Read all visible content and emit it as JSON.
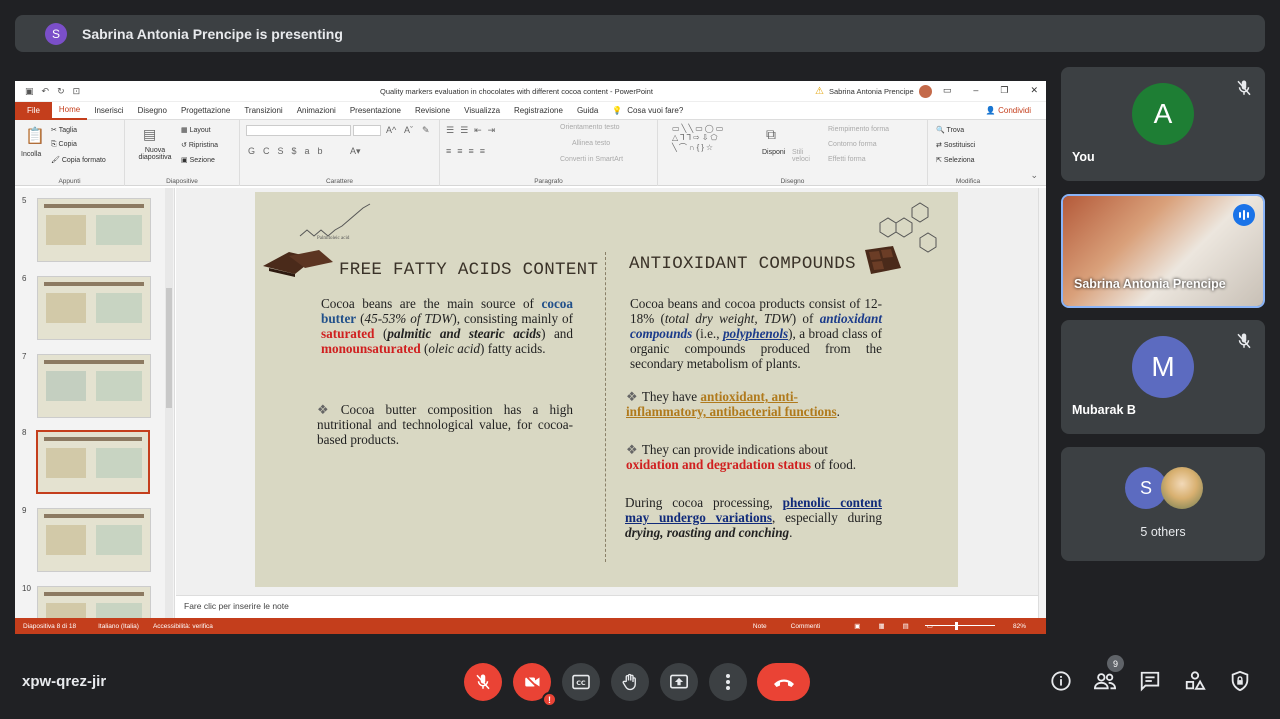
{
  "presenter_banner": {
    "avatar_letter": "S",
    "text": "Sabrina Antonia Prencipe is presenting"
  },
  "ppt": {
    "doc_title": "Quality markers evaluation in chocolates with different cocoa content  -  PowerPoint",
    "user_name": "Sabrina Antonia Prencipe",
    "menu": [
      "File",
      "Home",
      "Inserisci",
      "Disegno",
      "Progettazione",
      "Transizioni",
      "Animazioni",
      "Presentazione",
      "Revisione",
      "Visualizza",
      "Registrazione",
      "Guida"
    ],
    "tell_me": "Cosa vuoi fare?",
    "share": "Condividi",
    "ribbon": {
      "paste": "Incolla",
      "cut": "Taglia",
      "copy": "Copia",
      "format_painter": "Copia formato",
      "clipboard_group": "Appunti",
      "new_slide": "Nuova diapositiva",
      "layout": "Layout",
      "reset": "Ripristina",
      "section": "Sezione",
      "slides_group": "Diapositive",
      "font_group": "Carattere",
      "text_direction": "Orientamento testo",
      "align_text": "Allinea testo",
      "smartart": "Converti in SmartArt",
      "paragraph_group": "Paragrafo",
      "arrange": "Disponi",
      "styles": "Stili veloci",
      "fill": "Riempimento forma",
      "outline": "Contorno forma",
      "effects": "Effetti forma",
      "drawing_group": "Disegno",
      "find": "Trova",
      "replace": "Sostituisci",
      "select": "Seleziona",
      "edit_group": "Modifica"
    },
    "thumbnails": [
      {
        "num": "5",
        "title": "AIM OF THE STUDY"
      },
      {
        "num": "6",
        "title": "OCCURRENCE OF QUALITY MARKERS IN CHOCOLATE"
      },
      {
        "num": "7",
        "title": "POLYPHENOL CONTENT"
      },
      {
        "num": "8",
        "title": "FREE FATTY ACIDS CONTENT"
      },
      {
        "num": "9",
        "title": "OXIDATION AND DEGRADATION"
      },
      {
        "num": "10",
        "title": "PHENOLIC PROFILE"
      }
    ],
    "slide": {
      "caption_small": "Palmitoleic acid",
      "left_title": "FREE FATTY ACIDS CONTENT",
      "left_p1": {
        "a": "Cocoa beans are the main source of ",
        "b": "cocoa butter",
        "c": " (",
        "d": "45-53% of TDW",
        "e": "), consisting mainly of ",
        "f": "saturated",
        "g": " (",
        "h": "palmitic and stearic acids",
        "i": ") and ",
        "j": "monounsaturated",
        "k": " (",
        "l": "oleic acid",
        "m": ") fatty acids."
      },
      "left_p2": "Cocoa butter composition has a high nutritional and technological value, for cocoa-based products.",
      "right_title": "ANTIOXIDANT COMPOUNDS",
      "right_p1": {
        "a": "Cocoa beans and cocoa products consist of 12-18% (",
        "b": "total dry weight, TDW",
        "c": ") of ",
        "d": "antioxidant compounds",
        "e": " (i.e., ",
        "f": "polyphenols",
        "g": "), a broad class of organic compounds produced from the secondary metabolism of plants."
      },
      "right_p2": {
        "a": "They have ",
        "b": "antioxidant, anti-inflammatory, antibacterial functions",
        "c": "."
      },
      "right_p3": {
        "a": "They can provide indications about ",
        "b": "oxidation and degradation status",
        "c": " of food."
      },
      "right_p4": {
        "a": "During cocoa processing, ",
        "b": "phenolic content may undergo variations",
        "c": ", especially during ",
        "d": "drying, roasting and conching",
        "e": "."
      }
    },
    "notes_placeholder": "Fare clic per inserire le note",
    "status": {
      "slide_counter": "Diapositiva 8 di 18",
      "language": "Italiano (Italia)",
      "accessibility": "Accessibilità: verifica",
      "notes": "Note",
      "comments": "Commenti",
      "zoom": "82%"
    }
  },
  "participants": [
    {
      "letter": "A",
      "name": "You",
      "color": "#1e7e34"
    },
    {
      "name": "Sabrina Antonia Prencipe"
    },
    {
      "letter": "M",
      "name": "Mubarak B",
      "color": "#5c6bc0"
    },
    {
      "letter": "S",
      "name": "5 others",
      "color": "#5c6bc0"
    }
  ],
  "bottom": {
    "meeting_code": "xpw-qrez-jir",
    "people_count": "9",
    "colors": {
      "hangup": "#ea4335",
      "control_bg": "#3c4043"
    }
  }
}
